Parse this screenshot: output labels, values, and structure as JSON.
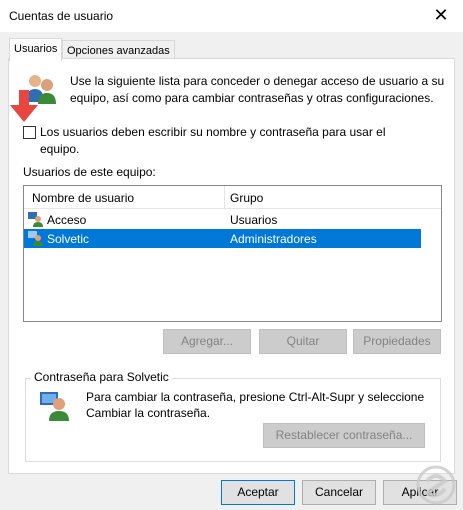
{
  "window": {
    "title": "Cuentas de usuario",
    "close_glyph": "✕"
  },
  "tabs": [
    {
      "label": "Usuarios",
      "active": true
    },
    {
      "label": "Opciones avanzadas",
      "active": false
    }
  ],
  "intro": {
    "line1": "Use la siguiente lista para conceder o denegar acceso de usuario a su",
    "line2": "equipo, así como para cambiar contraseñas y otras configuraciones.",
    "icon": "users-icon"
  },
  "require_login": {
    "line1": "Los usuarios deben escribir su nombre y contraseña para usar el",
    "line2": "equipo.",
    "checked": false
  },
  "users_section": {
    "label": "Usuarios de este equipo:",
    "columns": [
      "Nombre de usuario",
      "Grupo"
    ],
    "rows": [
      {
        "name": "Acceso",
        "group": "Usuarios",
        "selected": false
      },
      {
        "name": "Solvetic",
        "group": "Administradores",
        "selected": true
      }
    ]
  },
  "user_buttons": {
    "add": "Agregar...",
    "remove": "Quitar",
    "properties": "Propiedades"
  },
  "password_group": {
    "title": "Contraseña para Solvetic",
    "line1": "Para cambiar la contraseña, presione Ctrl-Alt-Supr y seleccione",
    "line2": "Cambiar la contraseña.",
    "reset_button": "Restablecer contraseña..."
  },
  "dialog_buttons": {
    "ok": "Aceptar",
    "cancel": "Cancelar",
    "apply": "Aplicar"
  },
  "colors": {
    "selection": "#0078d7",
    "arrow": "#e8473f"
  }
}
